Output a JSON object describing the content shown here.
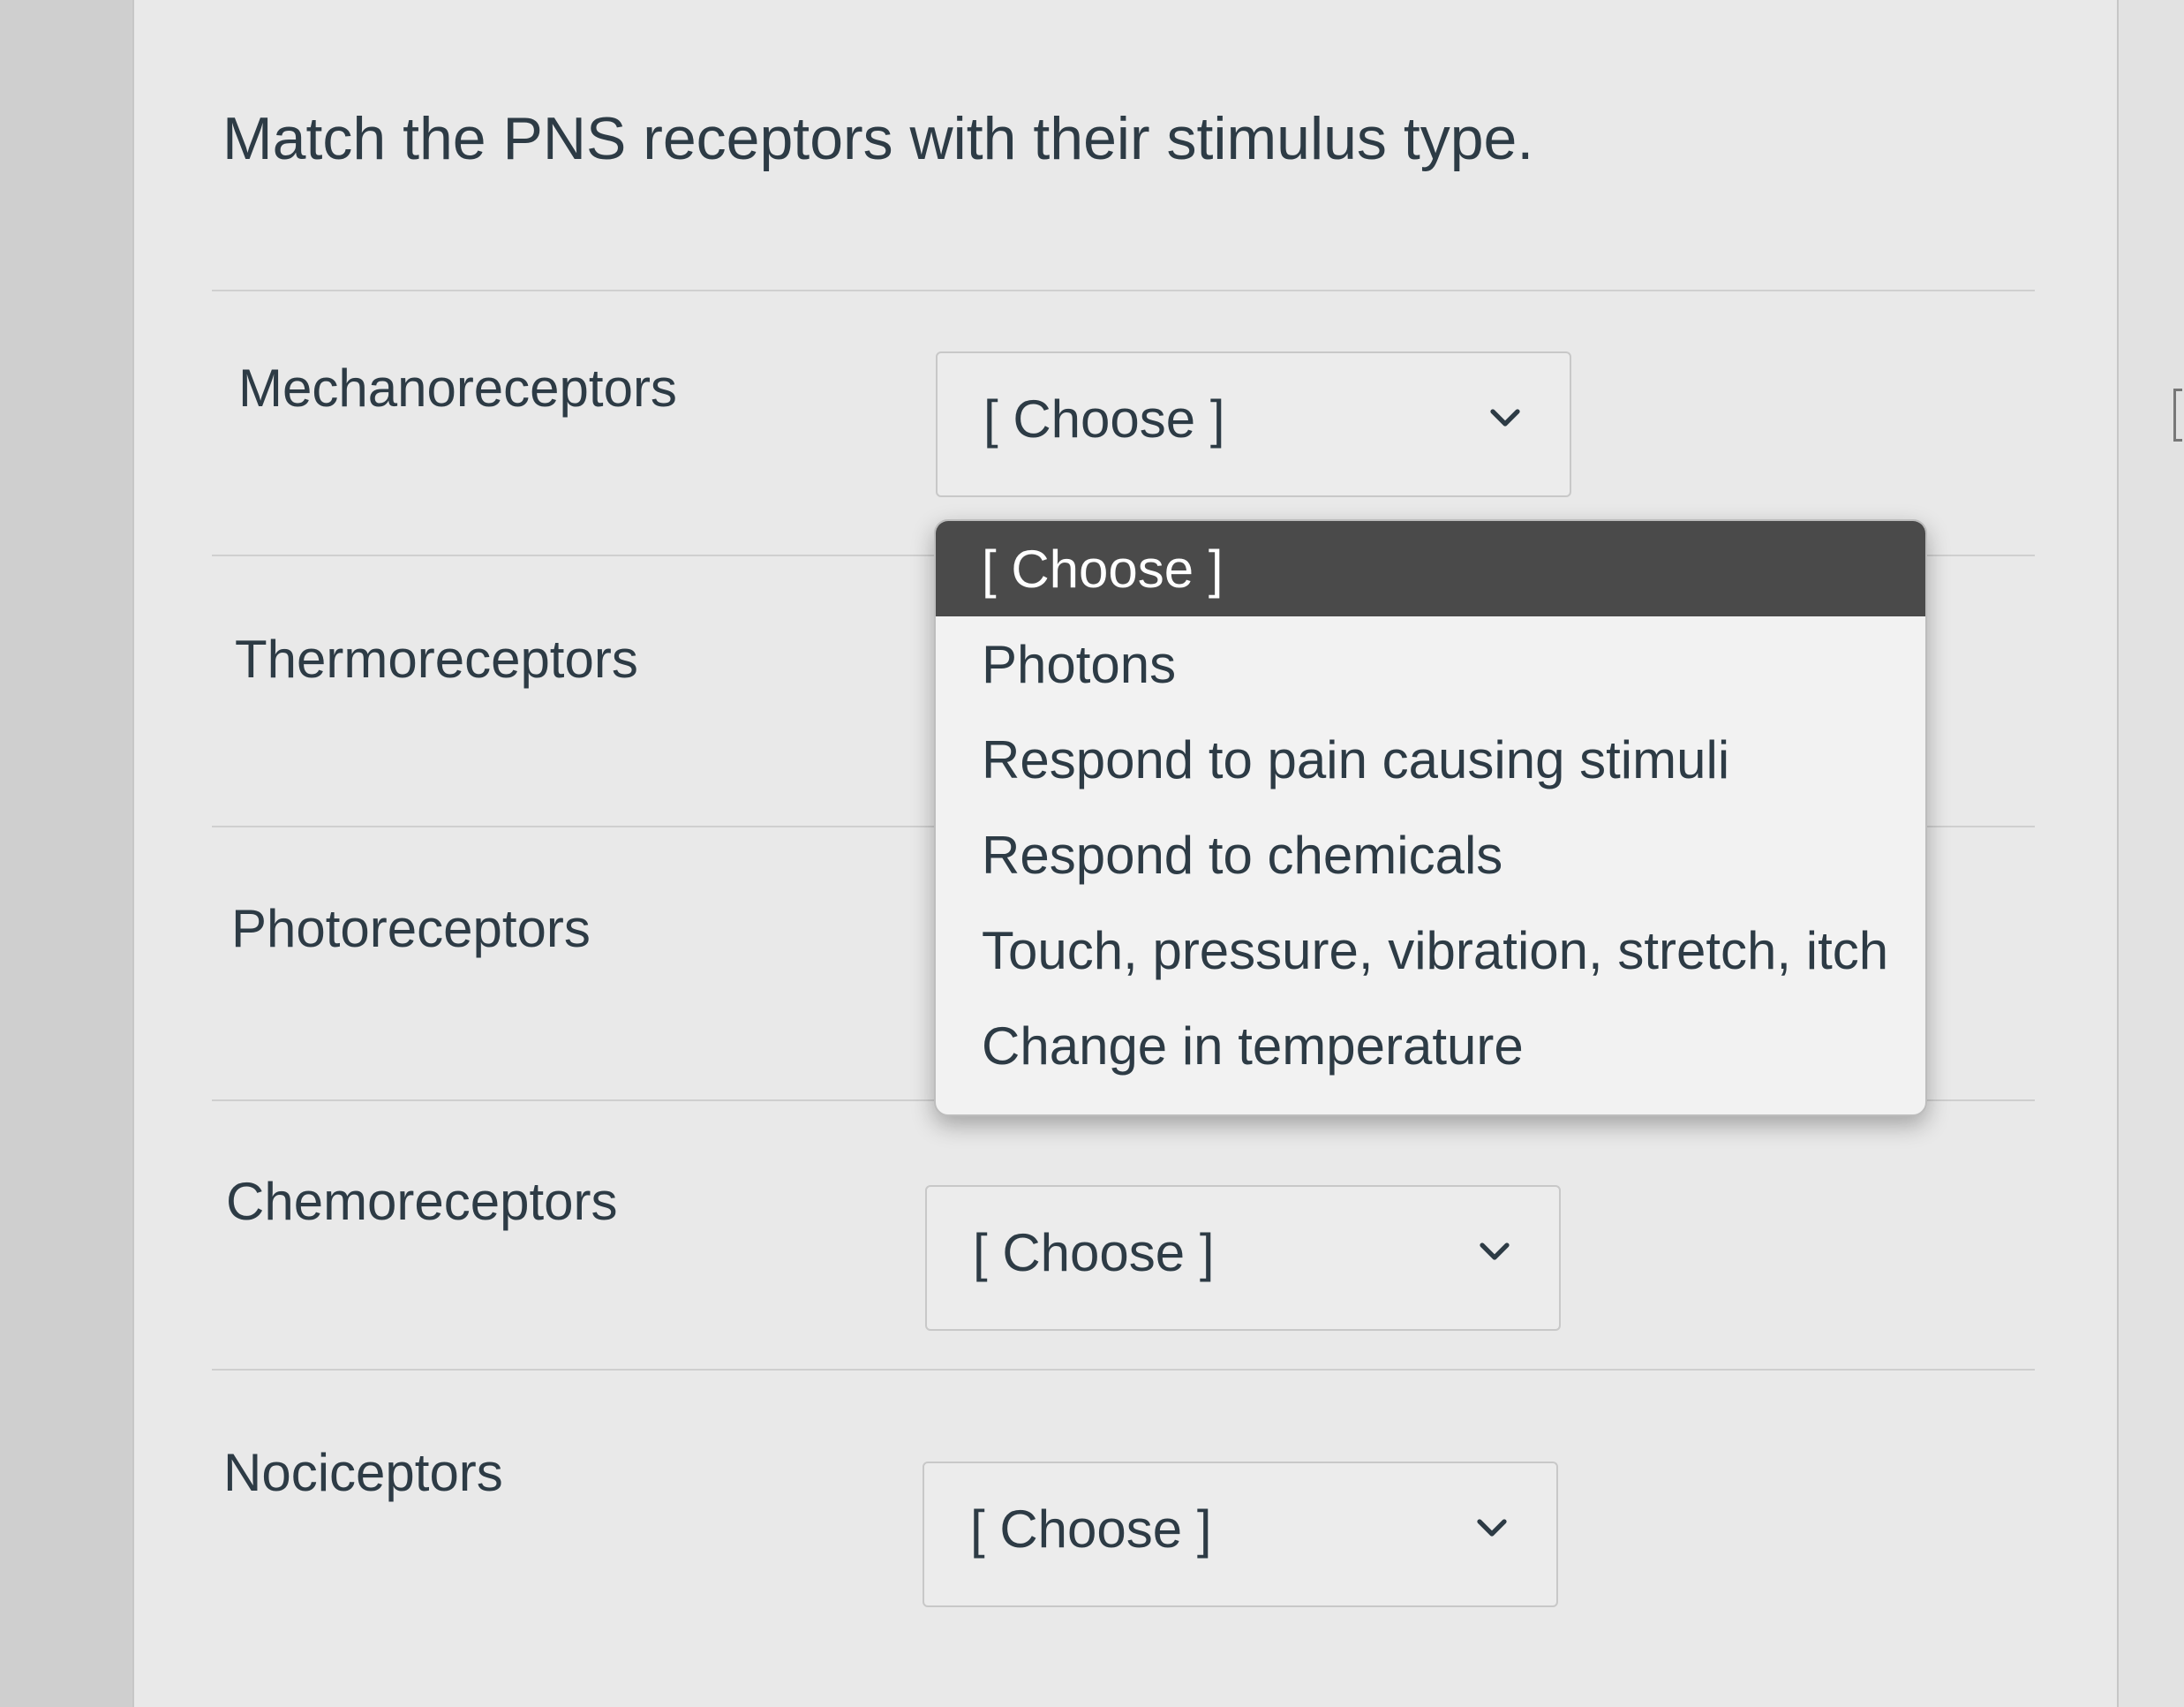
{
  "question": {
    "text": "Match the PNS receptors with their stimulus type."
  },
  "rows": [
    {
      "label": "Mechanoreceptors",
      "selected_value": "[ Choose ]"
    },
    {
      "label": "Thermoreceptors",
      "selected_value": "[ Choose ]"
    },
    {
      "label": "Photoreceptors",
      "selected_value": "[ Choose ]"
    },
    {
      "label": "Chemoreceptors",
      "selected_value": "[ Choose ]"
    },
    {
      "label": "Nociceptors",
      "selected_value": "[ Choose ]"
    }
  ],
  "dropdown": {
    "open_for_row": "Mechanoreceptors",
    "highlighted_option": "[ Choose ]",
    "options": [
      "[ Choose ]",
      "Photons",
      "Respond to pain causing stimuli",
      "Respond to chemicals",
      "Touch, pressure, vibration, stretch, itch",
      "Change in temperature"
    ]
  },
  "icons": {
    "select_arrow": "chevron-down-icon"
  },
  "colors": {
    "text": "#2d3b45",
    "highlight_bg": "#4a4a4a",
    "highlight_text": "#ffffff",
    "card_bg": "#e9e9e9"
  }
}
